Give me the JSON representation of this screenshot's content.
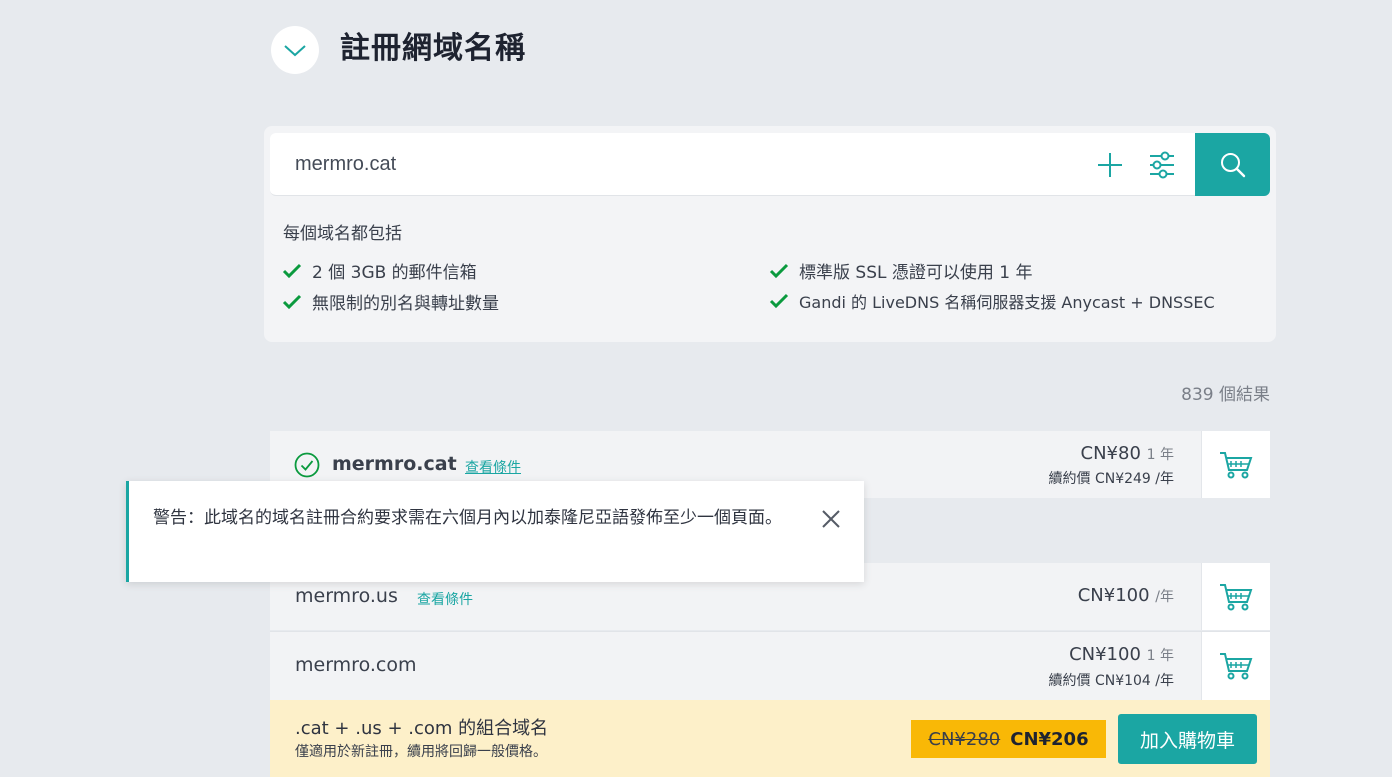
{
  "header": {
    "title": "註冊網域名稱"
  },
  "search": {
    "value": "mermro.cat",
    "placeholder": ""
  },
  "includes": {
    "title": "每個域名都包括",
    "features": [
      "2 個 3GB 的郵件信箱",
      "無限制的別名與轉址數量",
      "標準版 SSL 憑證可以使用 1 年",
      "Gandi 的 LiveDNS 名稱伺服器支援 Anycast + DNSSEC"
    ]
  },
  "results": {
    "count_label": "839 個結果",
    "rows": [
      {
        "domain": "mermro.cat",
        "terms": "查看條件",
        "price": "CN¥80",
        "price_unit": "1 年",
        "renew": "續約價 CN¥249 /年"
      },
      {
        "domain": "mermro.us",
        "terms": "查看條件",
        "price": "CN¥100",
        "price_unit": "/年"
      },
      {
        "domain": "mermro.com",
        "price": "CN¥100",
        "price_unit": "1 年",
        "renew": "續約價 CN¥104 /年"
      }
    ]
  },
  "warning": {
    "text": "警告：此域名的域名註冊合約要求需在六個月內以加泰隆尼亞語發佈至少一個頁面。"
  },
  "bundle": {
    "title": ".cat + .us + .com 的組合域名",
    "subtitle": "僅適用於新註冊，續用將回歸一般價格。",
    "old_price": "CN¥280",
    "new_price": "CN¥206",
    "add_button": "加入購物車"
  },
  "colors": {
    "accent": "#1ba6a3",
    "check": "#0a9a3e",
    "bundle_bg": "#fdf0c9",
    "price_tag": "#f9b806"
  }
}
